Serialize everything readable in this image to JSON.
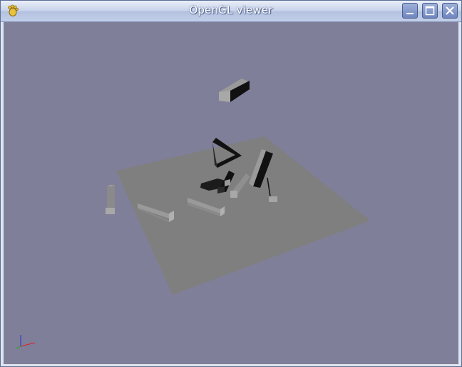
{
  "window": {
    "title": "OpenGL viewer",
    "buttons": {
      "minimize": "minimize",
      "maximize": "maximize",
      "close": "close"
    }
  },
  "icons": {
    "app": "gnome-foot-icon",
    "minimize": "minimize-icon",
    "maximize": "maximize-icon",
    "close": "close-icon",
    "axes": "axes-gizmo-icon"
  },
  "colors": {
    "viewport_background": "#7f7f99",
    "ground_plane": "#7f7f7f",
    "block_light": "#9a9a9a",
    "block_dark": "#111111",
    "axis_x": "#dd2222",
    "axis_y": "#22aa22",
    "axis_z": "#2233dd"
  }
}
